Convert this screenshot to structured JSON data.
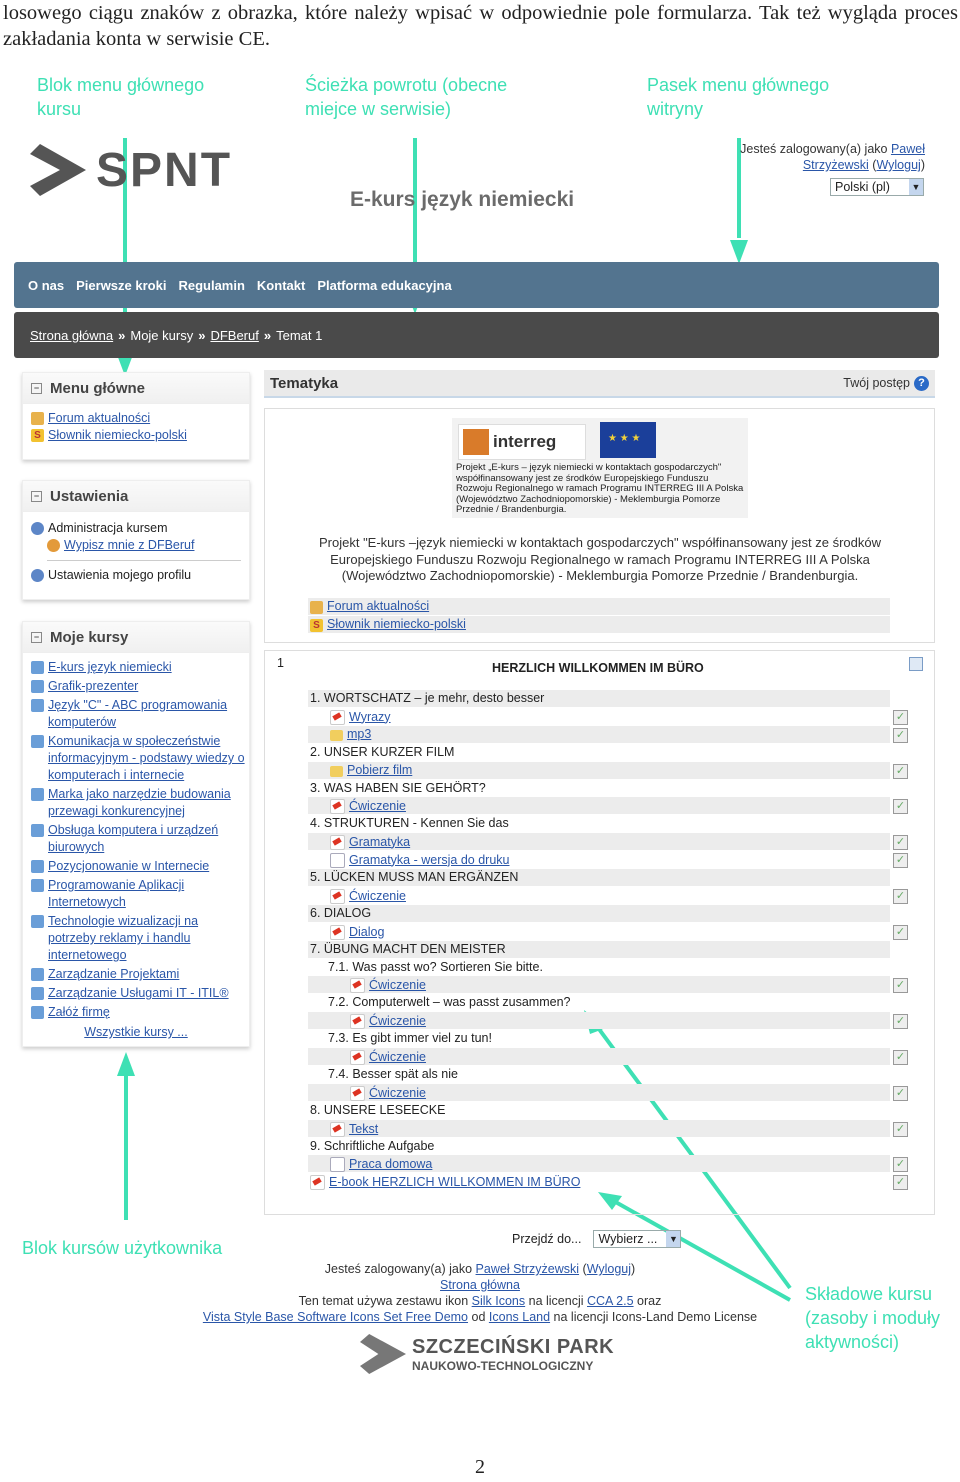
{
  "intro": "losowego ciągu znaków z obrazka, które należy wpisać w odpowiednie pole formularza. Tak też wygląda proces zakładania konta w serwisie CE.",
  "annotations": {
    "main_menu_block": "Blok menu głównego kursu",
    "breadcrumb": "Ścieżka powrotu (obecne miejce w serwisie)",
    "site_menu": "Pasek menu głównego witryny",
    "user_courses": "Blok kursów użytkownika",
    "course_components": "Składowe kursu (zasoby i moduły aktywności)"
  },
  "header": {
    "logo": "SPNT",
    "course_title": "E-kurs język niemiecki",
    "logged_prefix": "Jesteś zalogowany(a) jako",
    "user_name": "Paweł Strzyżewski",
    "logout": "Wyloguj",
    "language": "Polski (pl)"
  },
  "nav": [
    "O nas",
    "Pierwsze kroki",
    "Regulamin",
    "Kontakt",
    "Platforma edukacyjna"
  ],
  "breadcrumb": [
    "Strona główna",
    "Moje kursy",
    "DFBeruf",
    "Temat 1"
  ],
  "blocks": {
    "main_menu": {
      "title": "Menu główne",
      "items": [
        "Forum aktualności",
        "Słownik niemiecko-polski"
      ]
    },
    "settings": {
      "title": "Ustawienia",
      "admin": "Administracja kursem",
      "unenrol": "Wypisz mnie z DFBeruf",
      "profile": "Ustawienia mojego profilu"
    },
    "my_courses": {
      "title": "Moje kursy",
      "courses": [
        "E-kurs język niemiecki",
        "Grafik-prezenter",
        "Język \"C\" - ABC programowania komputerów",
        "Komunikacja w społeczeństwie informacyjnym - podstawy wiedzy o komputerach i internecie",
        "Marka jako narzędzie budowania przewagi konkurencyjnej",
        "Obsługa komputera i urządzeń biurowych",
        "Pozycjonowanie w Internecie",
        "Programowanie Aplikacji Internetowych",
        "Technologie wizualizacji na potrzeby reklamy i handlu internetowego",
        "Zarządzanie Projektami",
        "Zarządzanie Usługami IT - ITIL®",
        "Załóż firmę"
      ],
      "all": "Wszystkie kursy ..."
    }
  },
  "main": {
    "title": "Tematyka",
    "progress": "Twój postęp",
    "interreg_logo": "interreg",
    "interreg_text": "Projekt „E-kurs – język niemiecki w kontaktach gospodarczych\" współfinansowany jest ze środków Europejskiego Funduszu Rozwoju Regionalnego w ramach Programu INTERREG III A Polska (Województwo Zachodniopomorskie) - Meklemburgia Pomorze Przednie / Brandenburgia.",
    "project_text": "Projekt \"E-kurs –język niemiecki w kontaktach gospodarczych\" współfinansowany jest ze środków Europejskiego Funduszu Rozwoju Regionalnego w ramach Programu INTERREG III A Polska (Województwo Zachodniopomorskie) - Meklemburgia Pomorze Przednie / Brandenburgia.",
    "forum": "Forum aktualności",
    "dict": "Słownik niemiecko-polski",
    "topic_num": "1",
    "topic_title": "HERZLICH WILLKOMMEN IM BÜRO"
  },
  "topic_rows": [
    {
      "text": "1. WORTSCHATZ – je mehr, desto besser",
      "type": "label"
    },
    {
      "text": "Wyrazy",
      "type": "pdf"
    },
    {
      "text": "mp3",
      "type": "folder"
    },
    {
      "text": "2. UNSER KURZER FILM",
      "type": "label"
    },
    {
      "text": "Pobierz film",
      "type": "folder"
    },
    {
      "text": "3. WAS HABEN SIE GEHÖRT?",
      "type": "label"
    },
    {
      "text": "Ćwiczenie",
      "type": "pdf"
    },
    {
      "text": "4. STRUKTUREN - Kennen Sie das",
      "type": "label"
    },
    {
      "text": "Gramatyka",
      "type": "pdf"
    },
    {
      "text": "Gramatyka - wersja do druku",
      "type": "doc"
    },
    {
      "text": "5. LÜCKEN MUSS MAN ERGÄNZEN",
      "type": "label"
    },
    {
      "text": "Ćwiczenie",
      "type": "pdf"
    },
    {
      "text": "6. DIALOG",
      "type": "label"
    },
    {
      "text": "Dialog",
      "type": "pdf"
    },
    {
      "text": "7. ÜBUNG MACHT DEN MEISTER",
      "type": "label"
    },
    {
      "text": "7.1. Was passt wo? Sortieren Sie bitte.",
      "type": "sublabel"
    },
    {
      "text": "Ćwiczenie",
      "type": "subpdf"
    },
    {
      "text": "7.2. Computerwelt – was passt zusammen?",
      "type": "sublabel"
    },
    {
      "text": "Ćwiczenie",
      "type": "subpdf"
    },
    {
      "text": "7.3. Es gibt immer viel zu tun!",
      "type": "sublabel"
    },
    {
      "text": "Ćwiczenie",
      "type": "subpdf"
    },
    {
      "text": "7.4. Besser spät als nie",
      "type": "sublabel"
    },
    {
      "text": "Ćwiczenie",
      "type": "subpdf"
    },
    {
      "text": "8. UNSERE LESEECKE",
      "type": "label"
    },
    {
      "text": "Tekst",
      "type": "pdf"
    },
    {
      "text": "9. Schriftliche Aufgabe",
      "type": "label"
    },
    {
      "text": "Praca domowa",
      "type": "doc"
    },
    {
      "text": "E-book HERZLICH WILLKOMMEN IM BÜRO",
      "type": "bigpdf"
    }
  ],
  "footer": {
    "jump_label": "Przejdź do...",
    "jump_value": "Wybierz ...",
    "logged_prefix": "Jesteś zalogowany(a) jako",
    "user_name": "Paweł Strzyżewski",
    "logout": "Wyloguj",
    "home": "Strona główna",
    "theme_1": "Ten temat używa zestawu ikon",
    "silk": "Silk Icons",
    "theme_2": "na licencji",
    "cca": "CCA 2.5",
    "theme_3": "oraz",
    "vista": "Vista Style Base Software Icons Set Free Demo",
    "theme_4": "od",
    "iconsland": "Icons Land",
    "theme_5": "na licencji Icons-Land Demo License",
    "ssnt_1": "SZCZECIŃSKI PARK",
    "ssnt_2": "NAUKOWO-TECHNOLOGICZNY"
  },
  "page_number": "2"
}
